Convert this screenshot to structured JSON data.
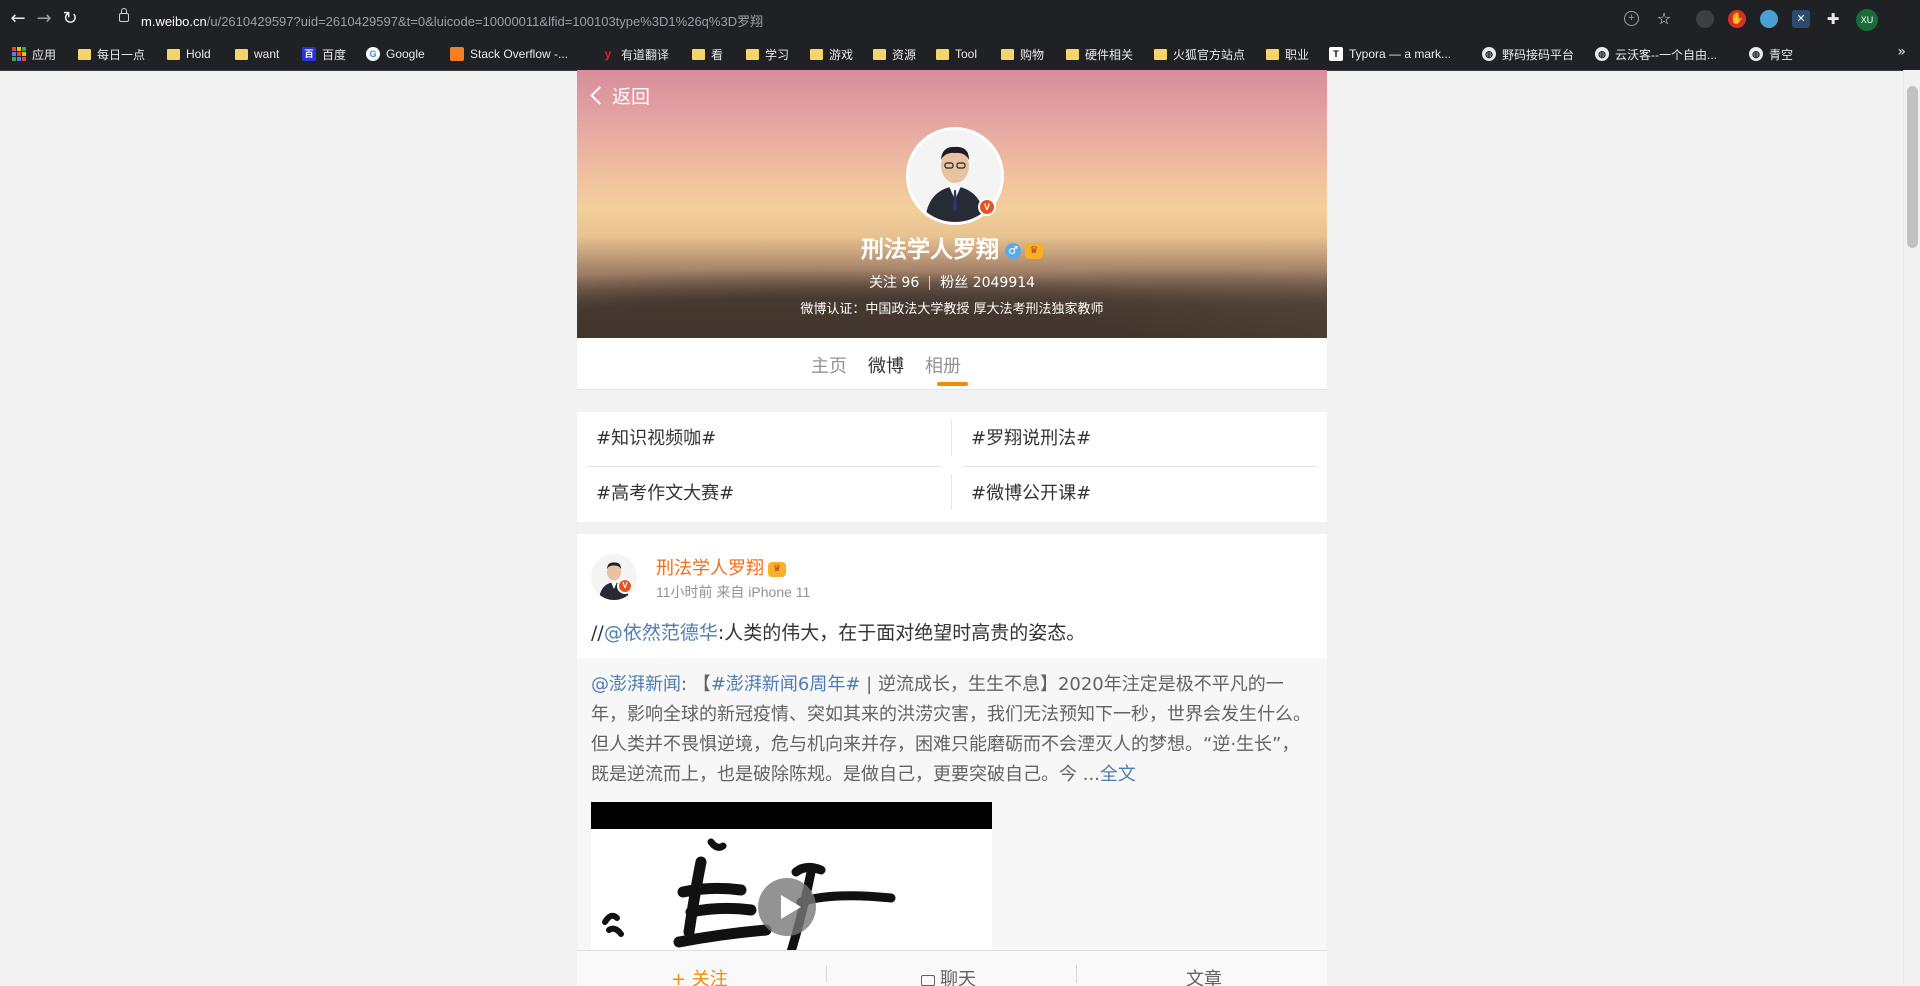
{
  "browser": {
    "url_host": "m.weibo.cn",
    "url_rest": "/u/2610429597?uid=2610429597&t=0&luicode=10000011&lfid=100103type%3D1%26q%3D罗翔",
    "profile_initials": "XU",
    "bookmarks": [
      {
        "label": "应用",
        "icon": "apps-grid-icon"
      },
      {
        "label": "每日一点",
        "icon": "folder-icon"
      },
      {
        "label": "Hold",
        "icon": "folder-icon"
      },
      {
        "label": "want",
        "icon": "folder-icon"
      },
      {
        "label": "百度",
        "icon": "baidu-icon"
      },
      {
        "label": "Google",
        "icon": "google-icon"
      },
      {
        "label": "Stack Overflow -...",
        "icon": "stackoverflow-icon"
      },
      {
        "label": "有道翻译",
        "icon": "youdao-icon"
      },
      {
        "label": "看",
        "icon": "folder-icon"
      },
      {
        "label": "学习",
        "icon": "folder-icon"
      },
      {
        "label": "游戏",
        "icon": "folder-icon"
      },
      {
        "label": "资源",
        "icon": "folder-icon"
      },
      {
        "label": "Tool",
        "icon": "folder-icon"
      },
      {
        "label": "购物",
        "icon": "folder-icon"
      },
      {
        "label": "硬件相关",
        "icon": "folder-icon"
      },
      {
        "label": "火狐官方站点",
        "icon": "folder-icon"
      },
      {
        "label": "职业",
        "icon": "folder-icon"
      },
      {
        "label": "Typora — a mark...",
        "icon": "typora-icon"
      },
      {
        "label": "野码接码平台",
        "icon": "globe-icon"
      },
      {
        "label": "云沃客--一个自由...",
        "icon": "globe-icon"
      },
      {
        "label": "青空",
        "icon": "globe-icon"
      }
    ],
    "more_bookmarks": "»"
  },
  "profile": {
    "back_label": "返回",
    "name": "刑法学人罗翔",
    "gender_symbol": "♂",
    "follow_label": "关注",
    "follow_count": "96",
    "fans_label": "粉丝",
    "fans_count": "2049914",
    "certification": "微博认证：中国政法大学教授 厚大法考刑法独家教师",
    "v_mark": "V"
  },
  "tabs": [
    {
      "label": "主页",
      "active": false
    },
    {
      "label": "微博",
      "active": true
    },
    {
      "label": "相册",
      "active": false
    }
  ],
  "topics": [
    "#知识视频咖#",
    "#罗翔说刑法#",
    "#高考作文大赛#",
    "#微博公开课#"
  ],
  "post": {
    "author": "刑法学人罗翔",
    "meta": "11小时前 来自 iPhone 11",
    "text_prefix": "//",
    "mention": "@依然范德华",
    "text_body": ":人类的伟大，在于面对绝望时高贵的姿态。",
    "repost_mention": "@澎湃新闻",
    "repost_colon": ":",
    "repost_bracket_open": " 【",
    "repost_topic": "#澎湃新闻6周年#",
    "repost_body": " | 逆流成长，生生不息】2020年注定是极不平凡的一年，影响全球的新冠疫情、突如其来的洪涝灾害，我们无法预知下一秒，世界会发生什么。但人类并不畏惧逆境，危与机向来并存，困难只能磨砺而不会湮灭人的梦想。“逆·生长”，既是逆流而上，也是破除陈规。是做自己，更要突破自己。今 ...",
    "full_text_link": "全文"
  },
  "bottom_bar": {
    "follow": "+ 关注",
    "chat": "聊天",
    "article": "文章"
  },
  "colors": {
    "accent_orange": "#f78b00",
    "author_orange": "#f86c14",
    "link_blue": "#507daf",
    "verify_red": "#e5541f"
  }
}
